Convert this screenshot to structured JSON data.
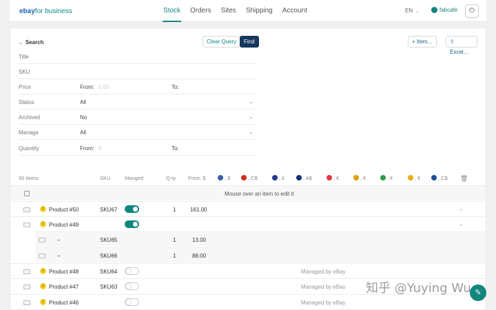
{
  "brand": {
    "ebay": "ebay",
    "forbusiness": "for business"
  },
  "nav": {
    "tabs": [
      "Stock",
      "Orders",
      "Sites",
      "Shipping",
      "Account"
    ],
    "active": "Stock"
  },
  "lang": "EN",
  "user": "fabcafe",
  "search": {
    "title": "Search",
    "clear_label": "Clear Query",
    "find_label": "Find",
    "item_button": "Item...",
    "excel_button": "Excel...",
    "fields": {
      "title": "Title",
      "sku": "SKU",
      "price": "Price",
      "from": "From:",
      "from_placeholder": "0.00",
      "to": "To:",
      "to_placeholder": "",
      "status": "Status",
      "status_value": "All",
      "archived": "Archived",
      "archived_value": "No",
      "manage": "Manage",
      "manage_value": "All",
      "quantity": "Quantity",
      "qty_from": "From:",
      "qty_from_placeholder": "0",
      "qty_to": "To:"
    }
  },
  "table": {
    "count": "50 Items",
    "cols": {
      "sku": "SKU",
      "managed": "Manged",
      "qty": "Q-ty",
      "price": "Price, $"
    },
    "currencies": [
      ", $",
      ", C$",
      ", £",
      ", A$",
      ", €",
      ", €",
      ", €",
      ", €",
      ", C$"
    ],
    "hint": "Mouse over an item to edit it",
    "rows": [
      {
        "name": "Product #50",
        "sku": "SKU67",
        "qty": "1",
        "price": "161.00",
        "dash": "-"
      },
      {
        "name": "Product #49",
        "dash": "-"
      },
      {
        "name": "–",
        "sku": "SKU65",
        "qty": "1",
        "price": "13.00"
      },
      {
        "name": "–",
        "sku": "SKU66",
        "qty": "1",
        "price": "88.00"
      },
      {
        "name": "Product #48",
        "sku": "SKU64",
        "managed": "Managed by eBay"
      },
      {
        "name": "Product #47",
        "sku": "SKU63",
        "managed": "Managed by eBay"
      },
      {
        "name": "Product #46",
        "managed": "Managed by eBay"
      }
    ]
  },
  "watermark": "知乎 @Yuying Wu",
  "colors": {
    "accent": "#11867f",
    "find": "#15375e",
    "warn": "#f4d02a"
  }
}
